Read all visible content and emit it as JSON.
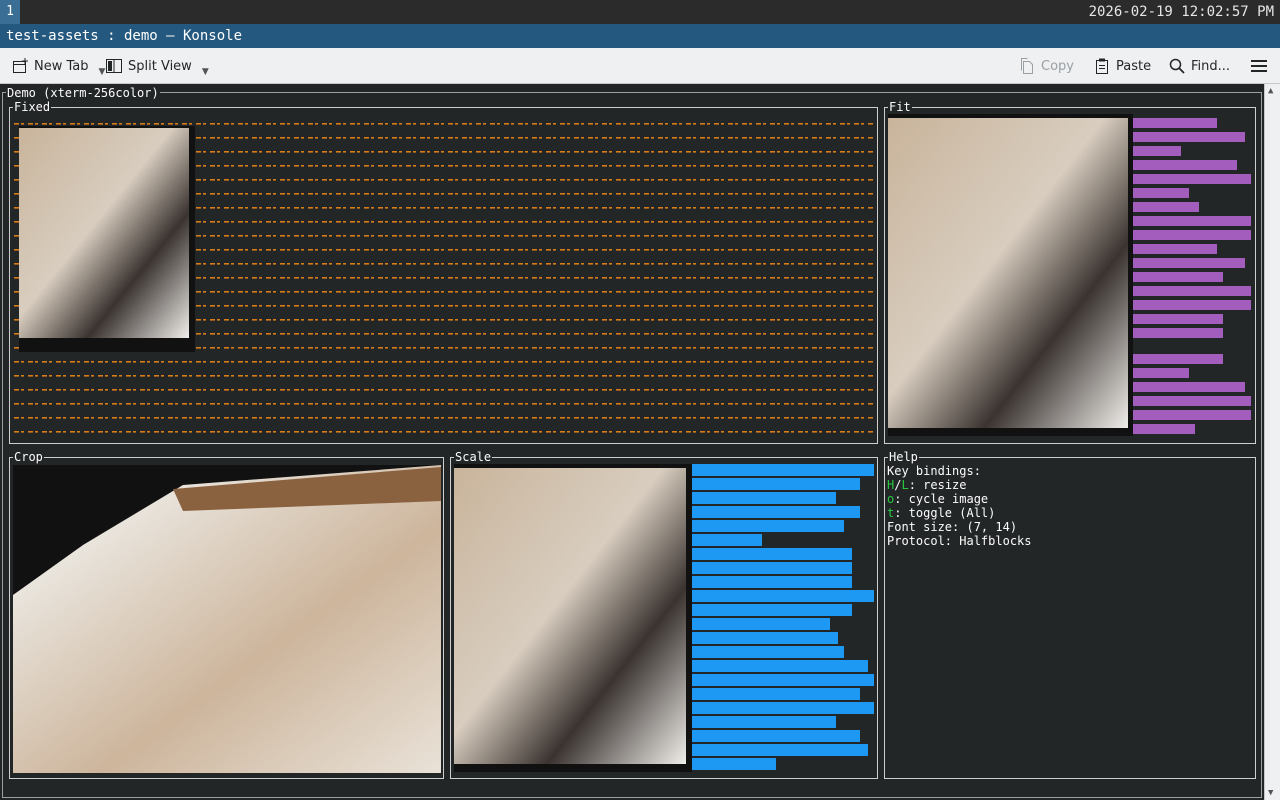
{
  "panel": {
    "workspace": "1",
    "clock": "2026-02-19 12:02:57 PM"
  },
  "window": {
    "title": "test-assets : demo — Konsole"
  },
  "toolbar": {
    "new_tab": "New Tab",
    "split_view": "Split View",
    "copy": "Copy",
    "paste": "Paste",
    "find": "Find..."
  },
  "terminal": {
    "outer_title": "Demo (xterm-256color)",
    "panes": {
      "fixed": "Fixed",
      "fit": "Fit",
      "crop": "Crop",
      "scale": "Scale",
      "help": "Help"
    },
    "help": {
      "heading": "Key bindings:",
      "resize_keys": [
        "H",
        "L"
      ],
      "resize_text": ": resize",
      "cycle_key": "o",
      "cycle_text": ": cycle image",
      "toggle_key": "t",
      "toggle_text": ": toggle (All)",
      "font_size": "Font size: (7, 14)",
      "protocol": "Protocol: Halfblocks"
    }
  },
  "colors": {
    "fixed_dots": "#d97b17",
    "fit_bars": "#a35dbd",
    "scale_bars": "#1d99f3",
    "key_highlight": "#27c93f",
    "titlebar": "#24587e"
  }
}
